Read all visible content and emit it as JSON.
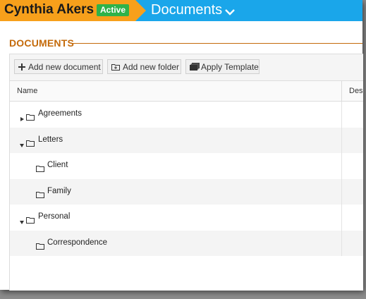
{
  "header": {
    "person_name": "Cynthia Akers",
    "status_badge": "Active",
    "breadcrumb_title": "Documents",
    "colors": {
      "left": "#f7a01b",
      "right": "#1aa6ea",
      "badge": "#2eb24a"
    }
  },
  "section": {
    "title": "DOCUMENTS",
    "accent": "#c46a0a"
  },
  "toolbar": {
    "add_document": "Add new document",
    "add_folder": "Add new folder",
    "apply_template": "Apply Template"
  },
  "grid": {
    "columns": {
      "name": "Name",
      "description": "Des"
    },
    "rows": [
      {
        "label": "Agreements",
        "level": 0,
        "toggle": "collapsed"
      },
      {
        "label": "Letters",
        "level": 0,
        "toggle": "expanded"
      },
      {
        "label": "Client",
        "level": 1,
        "toggle": "none"
      },
      {
        "label": "Family",
        "level": 1,
        "toggle": "none"
      },
      {
        "label": "Personal",
        "level": 0,
        "toggle": "expanded"
      },
      {
        "label": "Correspondence",
        "level": 1,
        "toggle": "none"
      }
    ]
  }
}
